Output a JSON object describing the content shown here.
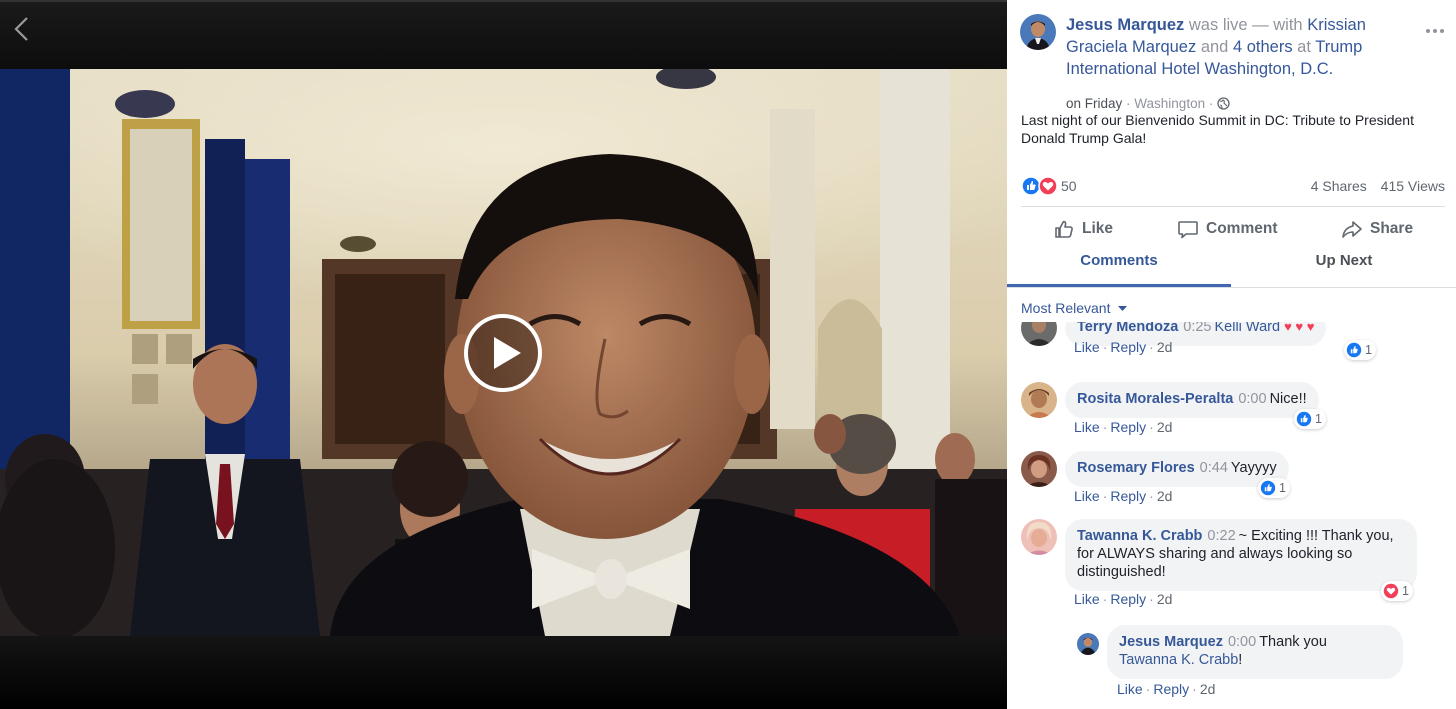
{
  "post": {
    "author": "Jesus Marquez",
    "was_live": "was live — with",
    "with_person": "Krissian Graciela Marquez",
    "and_text": "and",
    "others": "4 others",
    "at_text": "at",
    "location": "Trump International Hotel Washington, D.C.",
    "date": "on Friday",
    "place": "Washington",
    "caption": "Last night of our Bienvenido Summit in DC: Tribute to President Donald Trump Gala!",
    "reaction_count": "50",
    "shares": "4 Shares",
    "views": "415 Views"
  },
  "actions": {
    "like": "Like",
    "comment": "Comment",
    "share": "Share"
  },
  "tabs": {
    "comments": "Comments",
    "up_next": "Up Next"
  },
  "sort_label": "Most Relevant",
  "comments": [
    {
      "name": "Terry Mendoza",
      "time": "0:25",
      "text": "Kelli Ward",
      "like": "Like",
      "reply": "Reply",
      "age": "2d",
      "reaction_count": "1"
    },
    {
      "name": "Rosita Morales-Peralta",
      "time": "0:00",
      "text": "Nice!!",
      "like": "Like",
      "reply": "Reply",
      "age": "2d",
      "reaction_count": "1"
    },
    {
      "name": "Rosemary Flores",
      "time": "0:44",
      "text": "Yayyyy",
      "like": "Like",
      "reply": "Reply",
      "age": "2d",
      "reaction_count": "1"
    },
    {
      "name": "Tawanna K. Crabb",
      "time": "0:22",
      "text": "~ Exciting !!! Thank you, for ALWAYS sharing and always looking so distinguished!",
      "like": "Like",
      "reply": "Reply",
      "age": "2d",
      "reaction_count": "1"
    }
  ],
  "reply": {
    "name": "Jesus Marquez",
    "time": "0:00",
    "text_prefix": "Thank you",
    "mention": "Tawanna K. Crabb",
    "text_suffix": "!",
    "like": "Like",
    "reply": "Reply",
    "age": "2d"
  },
  "colors": {
    "link": "#365899",
    "like_blue": "#1877f2",
    "love_red": "#f33e58",
    "bubble": "#f2f3f5"
  },
  "icons": [
    "back-chevron-icon",
    "play-icon",
    "globe-icon",
    "like-reaction-icon",
    "love-reaction-icon",
    "thumbs-up-icon",
    "comment-icon",
    "share-icon",
    "caret-down-icon",
    "more-options-icon"
  ]
}
